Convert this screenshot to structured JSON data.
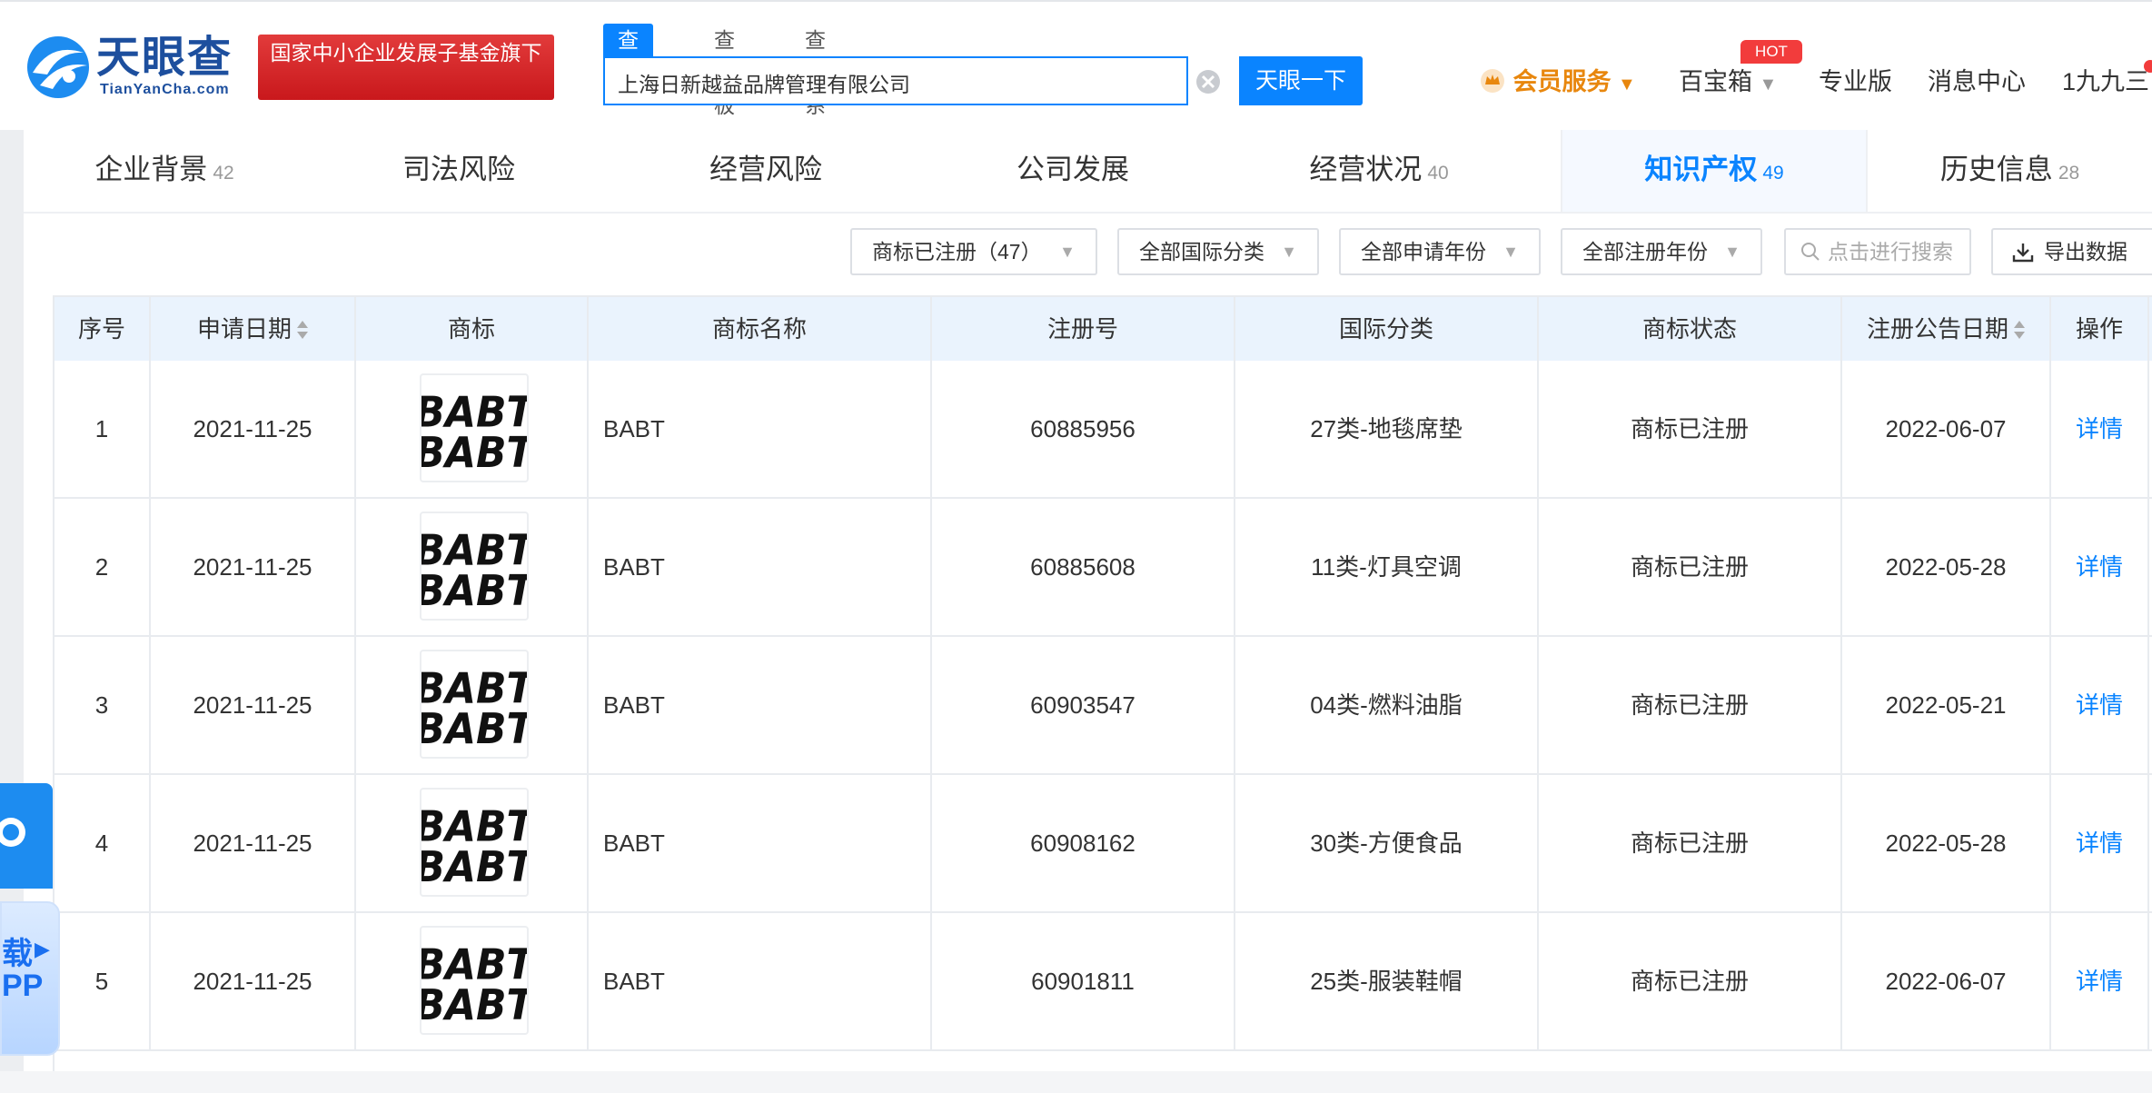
{
  "header": {
    "brand_cn": "天眼查",
    "brand_en": "TianYanCha.com",
    "promo_text": "国家中小企业发展子基金旗下",
    "search_tabs": [
      "查公司",
      "查老板",
      "查关系"
    ],
    "search_value": "上海日新越益品牌管理有限公司",
    "search_button": "天眼一下",
    "vip_label": "会员服务",
    "baobao_label": "百宝箱",
    "hot_badge": "HOT",
    "pro_label": "专业版",
    "message_label": "消息中心",
    "user_label": "1九九三"
  },
  "tabs": [
    {
      "label": "企业背景",
      "count": "42"
    },
    {
      "label": "司法风险",
      "count": ""
    },
    {
      "label": "经营风险",
      "count": ""
    },
    {
      "label": "公司发展",
      "count": ""
    },
    {
      "label": "经营状况",
      "count": "40"
    },
    {
      "label": "知识产权",
      "count": "49"
    },
    {
      "label": "历史信息",
      "count": "28"
    }
  ],
  "filters": {
    "status": "商标已注册（47）",
    "intl_class": "全部国际分类",
    "apply_year": "全部申请年份",
    "register_year": "全部注册年份",
    "search_placeholder": "点击进行搜索",
    "export": "导出数据"
  },
  "table": {
    "headers": [
      "序号",
      "申请日期",
      "商标",
      "商标名称",
      "注册号",
      "国际分类",
      "商标状态",
      "注册公告日期",
      "操作"
    ],
    "rows": [
      {
        "index": "1",
        "apply_date": "2021-11-25",
        "logo_text": "BABT",
        "name": "BABT",
        "reg_no": "60885956",
        "class": "27类-地毯席垫",
        "status": "商标已注册",
        "announce_date": "2022-06-07",
        "action": "详情"
      },
      {
        "index": "2",
        "apply_date": "2021-11-25",
        "logo_text": "BABT",
        "name": "BABT",
        "reg_no": "60885608",
        "class": "11类-灯具空调",
        "status": "商标已注册",
        "announce_date": "2022-05-28",
        "action": "详情"
      },
      {
        "index": "3",
        "apply_date": "2021-11-25",
        "logo_text": "BABT",
        "name": "BABT",
        "reg_no": "60903547",
        "class": "04类-燃料油脂",
        "status": "商标已注册",
        "announce_date": "2022-05-21",
        "action": "详情"
      },
      {
        "index": "4",
        "apply_date": "2021-11-25",
        "logo_text": "BABT",
        "name": "BABT",
        "reg_no": "60908162",
        "class": "30类-方便食品",
        "status": "商标已注册",
        "announce_date": "2022-05-28",
        "action": "详情"
      },
      {
        "index": "5",
        "apply_date": "2021-11-25",
        "logo_text": "BABT",
        "name": "BABT",
        "reg_no": "60901811",
        "class": "25类-服装鞋帽",
        "status": "商标已注册",
        "announce_date": "2022-06-07",
        "action": "详情"
      }
    ]
  },
  "app_widget": {
    "line1": "载",
    "line2": "PP"
  },
  "colors": {
    "accent": "#0a84ff",
    "promo": "#d42a2c",
    "vip": "#e8870e",
    "header_row": "#eaf3fd"
  }
}
